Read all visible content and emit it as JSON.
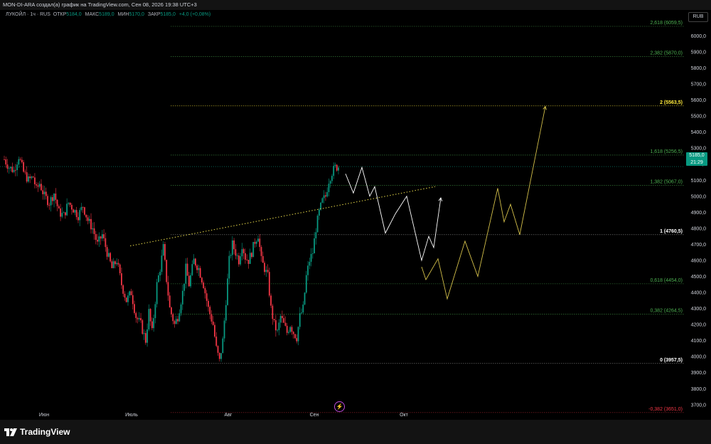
{
  "header": {
    "text": "MON-DI-ARA создал(а) график на TradingView.com, Сен 08, 2026 19:38 UTC+3"
  },
  "legend": {
    "symbol": "ЛУКОЙЛ · 1ч · RUS",
    "open_label": "ОТКР",
    "open": "5184,0",
    "high_label": "МАКС",
    "high": "5189,0",
    "low_label": "МИН",
    "low": "5170,0",
    "close_label": "ЗАКР",
    "close": "5185,0",
    "change": "+4,0 (+0,08%)"
  },
  "price_axis": {
    "currency": "RUB",
    "last_price": "5185,0",
    "countdown": "21:29"
  },
  "brand": {
    "name": "TradingView"
  },
  "colors": {
    "background": "#000000",
    "up": "#089981",
    "down": "#f23645",
    "fib_label": "#4caf50",
    "fib_key": "#ffffff",
    "fib_extension": "#ffeb3b",
    "fib_negative": "#f23645",
    "projection_white": "#ffffff",
    "projection_yellow": "#d4c04a"
  },
  "chart_data": {
    "type": "candlestick",
    "symbol": "ЛУКОЙЛ",
    "timeframe": "1ч",
    "y_ticks": [
      3700,
      3800,
      3900,
      4000,
      4100,
      4200,
      4300,
      4400,
      4500,
      4600,
      4700,
      4800,
      4900,
      5000,
      5100,
      5200,
      5300,
      5400,
      5500,
      5600,
      5700,
      5800,
      5900,
      6000
    ],
    "y_tick_labels": [
      "3700,0",
      "3800,0",
      "3900,0",
      "4000,0",
      "4100,0",
      "4200,0",
      "4300,0",
      "4400,0",
      "4500,0",
      "4600,0",
      "4700,0",
      "4800,0",
      "4900,0",
      "5000,0",
      "5100,0",
      "5200,0",
      "5300,0",
      "5400,0",
      "5500,0",
      "5600,0",
      "5700,0",
      "5800,0",
      "5900,0",
      "6000,0"
    ],
    "ylim": [
      3640,
      6110
    ],
    "x_ticks": [
      "Июн",
      "Июль",
      "Авг",
      "Сен",
      "Окт"
    ],
    "fib_levels": [
      {
        "ratio": "2,618",
        "price": 6059.5,
        "label": "2,618 (6059,5)",
        "kind": "ext"
      },
      {
        "ratio": "2,382",
        "price": 5870.0,
        "label": "2,382 (5870,0)",
        "kind": "ext"
      },
      {
        "ratio": "2",
        "price": 5563.5,
        "label": "2 (5563,5)",
        "kind": "key2"
      },
      {
        "ratio": "1,618",
        "price": 5256.5,
        "label": "1,618 (5256,5)",
        "kind": "ext"
      },
      {
        "ratio": "1,382",
        "price": 5067.0,
        "label": "1,382 (5067,0)",
        "kind": "ext"
      },
      {
        "ratio": "1",
        "price": 4760.5,
        "label": "1 (4760,5)",
        "kind": "key"
      },
      {
        "ratio": "0,618",
        "price": 4454.0,
        "label": "0,618 (4454,0)",
        "kind": "ext"
      },
      {
        "ratio": "0,382",
        "price": 4264.5,
        "label": "0,382 (4264,5)",
        "kind": "ext"
      },
      {
        "ratio": "0",
        "price": 3957.5,
        "label": "0 (3957,5)",
        "kind": "key"
      },
      {
        "ratio": "-0,382",
        "price": 3651.0,
        "label": "-0,382 (3651,0)",
        "kind": "neg"
      }
    ],
    "close_path": [
      [
        0,
        5230
      ],
      [
        3,
        5180
      ],
      [
        6,
        5160
      ],
      [
        9,
        5250
      ],
      [
        12,
        5150
      ],
      [
        15,
        5100
      ],
      [
        18,
        5120
      ],
      [
        20,
        5040
      ],
      [
        22,
        5080
      ],
      [
        25,
        5000
      ],
      [
        28,
        4960
      ],
      [
        31,
        5020
      ],
      [
        34,
        4900
      ],
      [
        37,
        4880
      ],
      [
        40,
        4960
      ],
      [
        43,
        4920
      ],
      [
        46,
        4880
      ],
      [
        49,
        4940
      ],
      [
        52,
        4850
      ],
      [
        55,
        4800
      ],
      [
        58,
        4700
      ],
      [
        61,
        4760
      ],
      [
        64,
        4650
      ],
      [
        67,
        4550
      ],
      [
        70,
        4600
      ],
      [
        73,
        4450
      ],
      [
        76,
        4350
      ],
      [
        79,
        4400
      ],
      [
        82,
        4250
      ],
      [
        85,
        4200
      ],
      [
        88,
        4100
      ],
      [
        90,
        4280
      ],
      [
        92,
        4150
      ],
      [
        95,
        4450
      ],
      [
        97,
        4550
      ],
      [
        99,
        4680
      ],
      [
        101,
        4480
      ],
      [
        103,
        4300
      ],
      [
        106,
        4200
      ],
      [
        108,
        4250
      ],
      [
        111,
        4400
      ],
      [
        113,
        4550
      ],
      [
        115,
        4450
      ],
      [
        118,
        4600
      ],
      [
        121,
        4550
      ],
      [
        124,
        4450
      ],
      [
        127,
        4300
      ],
      [
        130,
        4200
      ],
      [
        132,
        4050
      ],
      [
        134,
        3970
      ],
      [
        136,
        4100
      ],
      [
        138,
        4350
      ],
      [
        140,
        4600
      ],
      [
        142,
        4700
      ],
      [
        144,
        4650
      ],
      [
        146,
        4600
      ],
      [
        148,
        4700
      ],
      [
        150,
        4620
      ],
      [
        152,
        4600
      ],
      [
        154,
        4650
      ],
      [
        156,
        4720
      ],
      [
        158,
        4760
      ],
      [
        160,
        4600
      ],
      [
        162,
        4550
      ],
      [
        164,
        4500
      ],
      [
        166,
        4300
      ],
      [
        168,
        4200
      ],
      [
        170,
        4150
      ],
      [
        172,
        4250
      ],
      [
        174,
        4200
      ],
      [
        176,
        4150
      ],
      [
        178,
        4200
      ],
      [
        180,
        4150
      ],
      [
        182,
        4120
      ],
      [
        184,
        4250
      ],
      [
        186,
        4300
      ],
      [
        188,
        4500
      ],
      [
        190,
        4600
      ],
      [
        192,
        4650
      ],
      [
        194,
        4800
      ],
      [
        196,
        4900
      ],
      [
        198,
        4970
      ],
      [
        200,
        5000
      ],
      [
        202,
        5100
      ],
      [
        204,
        5150
      ],
      [
        206,
        5180
      ],
      [
        208,
        5185
      ]
    ],
    "trendline": {
      "from": [
        0.9,
        4690
      ],
      "to": [
        2.98,
        5060
      ]
    },
    "projection_white": [
      [
        486,
        5140
      ],
      [
        497,
        5020
      ],
      [
        509,
        5180
      ],
      [
        520,
        5000
      ],
      [
        527,
        5060
      ],
      [
        542,
        4770
      ],
      [
        556,
        4890
      ],
      [
        572,
        5000
      ],
      [
        593,
        4600
      ],
      [
        603,
        4750
      ],
      [
        610,
        4680
      ],
      [
        620,
        4990
      ]
    ],
    "projection_yellow": [
      [
        593,
        4560
      ],
      [
        599,
        4480
      ],
      [
        616,
        4610
      ],
      [
        629,
        4360
      ],
      [
        654,
        4720
      ],
      [
        672,
        4500
      ],
      [
        700,
        5050
      ],
      [
        709,
        4840
      ],
      [
        718,
        4950
      ],
      [
        731,
        4760
      ],
      [
        767,
        5560
      ]
    ]
  }
}
